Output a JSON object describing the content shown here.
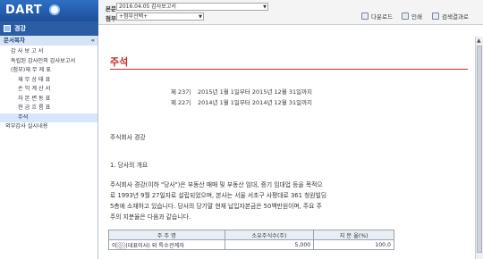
{
  "app": {
    "logo_text": "DART",
    "company": "경강"
  },
  "header": {
    "report_label": "본문",
    "report_value": "2016.04.05 감사보고서",
    "attach_label": "첨부",
    "attach_value": "+첨부선택+",
    "toolbar": {
      "download": "다운로드",
      "print": "인쇄",
      "search_results": "검색결과로"
    }
  },
  "sidebar": {
    "title": "문서목차",
    "collapse": "«",
    "items": [
      {
        "label": "감 사 보 고 서",
        "indent": 1
      },
      {
        "label": "독립된 감사인의 감사보고서",
        "indent": 1
      },
      {
        "label": "(첨부)재 무 제 표",
        "indent": 1
      },
      {
        "label": "재 무 상 태 표",
        "indent": 2
      },
      {
        "label": "손 익 계 산 서",
        "indent": 2
      },
      {
        "label": "자 본 변 동 표",
        "indent": 2
      },
      {
        "label": "현 금 흐 름 표",
        "indent": 2
      },
      {
        "label": "주석",
        "indent": 2,
        "active": true
      },
      {
        "label": "외부감사 실시내용",
        "indent": 0
      }
    ]
  },
  "document": {
    "title": "주석",
    "period1_label": "제 23기",
    "period1_range": "2015년 1월 1일부터   2015년 12월 31일까지",
    "period2_label": "제 22기",
    "period2_range": "2014년 1월 1일부터   2014년 12월 31일까지",
    "company_line": "주식회사 경강",
    "section1": "1. 당사의 개요",
    "para_lines": [
      "주식회사 경강(이하 \"당사\")은 부동산 매매 및 부동산 임대, 증기 임대업 등을 목적으",
      "로 1993년 9월 27일자로 설립되었으며, 본사는 서울 서초구 사평대로 361 청원빌딩",
      "5층에 소재하고 있습니다. 당사의 당기말 현재 납입자본금은 50백만원이며, 주요 주",
      "주의 지분율은 다음과 같습니다."
    ],
    "table": {
      "headers": [
        "주 주 명",
        "소유주식수(주)",
        "지 분 율(%)"
      ],
      "rows": [
        [
          "이░░(대표이사) 외 특수관계자",
          "5,000",
          "100.0"
        ]
      ]
    }
  }
}
